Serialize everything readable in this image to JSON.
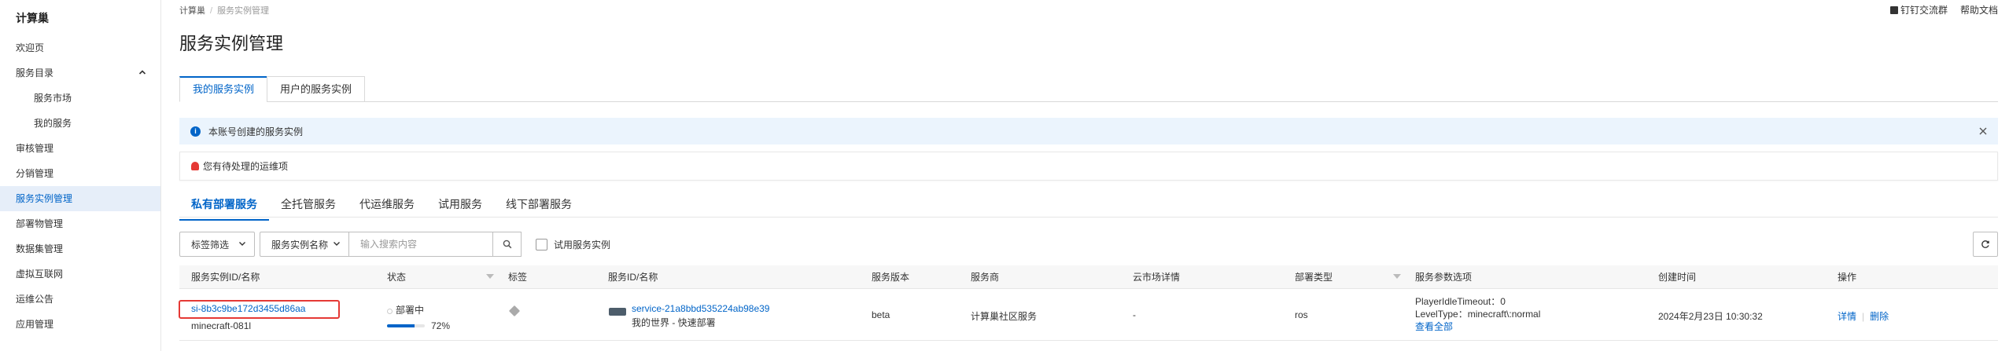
{
  "sidebar": {
    "brand": "计算巢",
    "items": [
      {
        "label": "欢迎页"
      },
      {
        "label": "服务目录"
      },
      {
        "label": "服务市场"
      },
      {
        "label": "我的服务"
      },
      {
        "label": "审核管理"
      },
      {
        "label": "分销管理"
      },
      {
        "label": "服务实例管理"
      },
      {
        "label": "部署物管理"
      },
      {
        "label": "数据集管理"
      },
      {
        "label": "虚拟互联网"
      },
      {
        "label": "运维公告"
      },
      {
        "label": "应用管理"
      }
    ],
    "collapse_icon": "chevron-up-icon"
  },
  "header": {
    "breadcrumb_root": "计算巢",
    "breadcrumb_sep": "/",
    "breadcrumb_current": "服务实例管理",
    "dingtalk_label": "钉钉交流群",
    "help_label": "帮助文档"
  },
  "page": {
    "title": "服务实例管理"
  },
  "box_tabs": [
    {
      "label": "我的服务实例",
      "active": true
    },
    {
      "label": "用户的服务实例",
      "active": false
    }
  ],
  "info_banner": {
    "text": "本账号创建的服务实例",
    "icon": "info-icon"
  },
  "alert": {
    "text": "您有待处理的运维项",
    "icon": "bell-icon"
  },
  "sub_tabs": [
    {
      "label": "私有部署服务",
      "active": true
    },
    {
      "label": "全托管服务",
      "active": false
    },
    {
      "label": "代运维服务",
      "active": false
    },
    {
      "label": "试用服务",
      "active": false
    },
    {
      "label": "线下部署服务",
      "active": false
    }
  ],
  "toolbar": {
    "tag_filter_label": "标签筛选",
    "search_field_label": "服务实例名称",
    "search_placeholder": "输入搜索内容",
    "trial_checkbox_label": "试用服务实例"
  },
  "table": {
    "columns": {
      "instance": "服务实例ID/名称",
      "status": "状态",
      "tags": "标签",
      "service": "服务ID/名称",
      "version": "服务版本",
      "provider": "服务商",
      "market": "云市场详情",
      "deploy_type": "部署类型",
      "params": "服务参数选项",
      "created": "创建时间",
      "actions": "操作"
    },
    "row": {
      "instance_id": "si-8b3c9be172d3455d86aa",
      "instance_name": "minecraft-081l",
      "status": "部署中",
      "progress_text": "72%",
      "progress": 0.72,
      "service_id": "service-21a8bbd535224ab98e39",
      "service_name": "我的世界 - 快速部署",
      "version": "beta",
      "provider": "计算巢社区服务",
      "market": "-",
      "deploy_type": "ros",
      "param_1": "PlayerIdleTimeout：0",
      "param_2": "LevelType：minecraft\\:normal",
      "view_all": "查看全部",
      "created": "2024年2月23日 10:30:32",
      "detail_action": "详情",
      "delete_action": "删除"
    }
  },
  "colors": {
    "accent": "#0064c8",
    "highlight": "#e53935",
    "banner_bg": "#ebf4fd"
  }
}
